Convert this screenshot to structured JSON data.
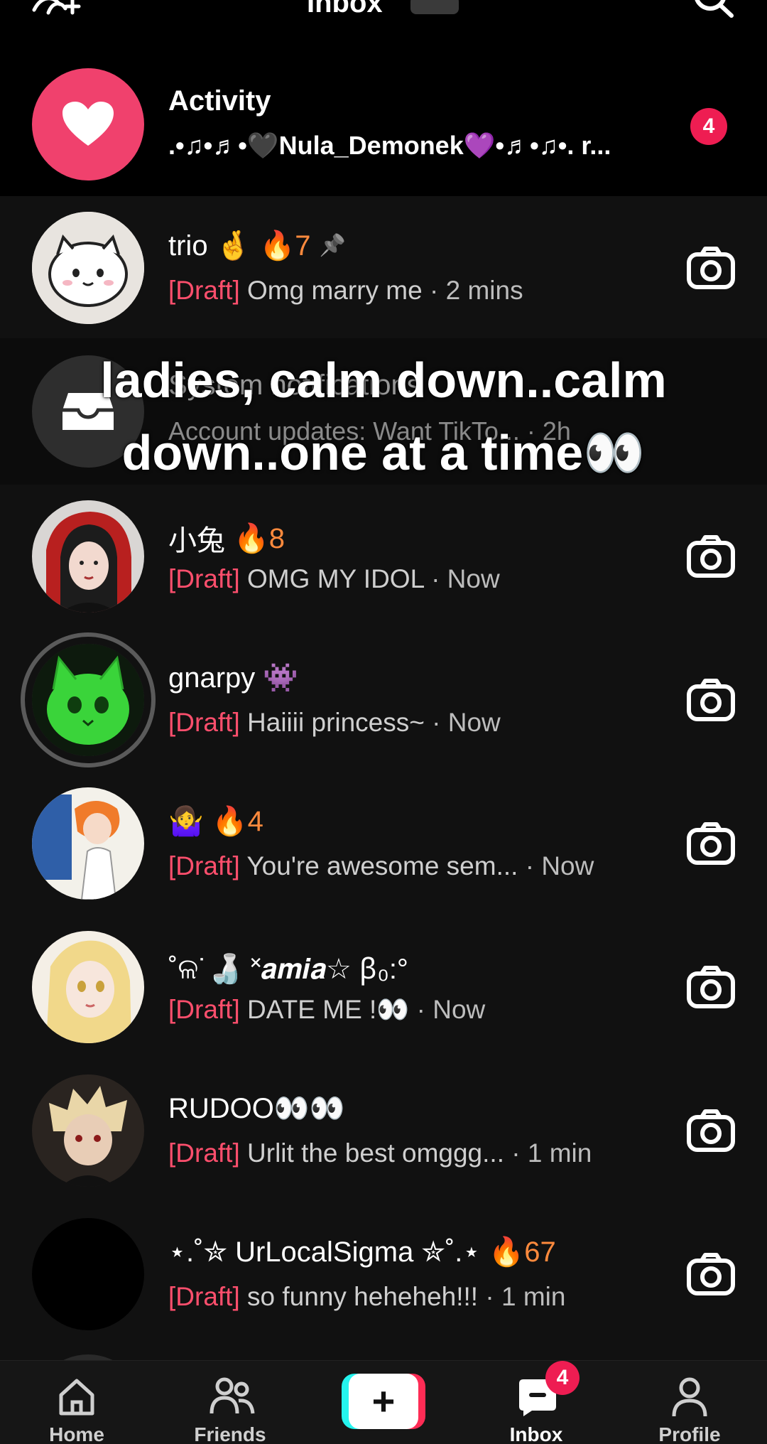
{
  "header": {
    "title": "Inbox"
  },
  "activity": {
    "name": "Activity",
    "subtitle": ".•♫•♬•🖤Nula_Demonek💜•♬•♫•. r...",
    "badge": "4"
  },
  "caption": {
    "line1": "ladies, calm down..calm",
    "line2": "down..one at a time👀"
  },
  "system_row_ghost": {
    "title": "System notifications",
    "subtitle": "Account updates: Want TikTo... · 2h"
  },
  "conversations": [
    {
      "name": "trio 🤞",
      "streak": "🔥7",
      "pinned": "📌",
      "draft": "[Draft]",
      "message": "Omg marry me",
      "time": "· 2 mins"
    },
    {
      "name": "小兔",
      "streak": "🔥8",
      "draft": "[Draft]",
      "message": "OMG MY IDOL",
      "time": "· Now"
    },
    {
      "name": "gnarpy 👾",
      "streak": "",
      "draft": "[Draft]",
      "message": "Haiiii princess~",
      "time": "· Now"
    },
    {
      "name": "🤷‍♀️",
      "streak": "🔥4",
      "draft": "[Draft]",
      "message": "You're awesome sem...",
      "time": "· Now"
    },
    {
      "name": "˚ଳ˙🍶 ˟𝒂𝒎𝒊𝒂☆ ꞵ₀:°",
      "streak": "",
      "draft": "[Draft]",
      "message": "DATE ME !👀",
      "time": "· Now"
    },
    {
      "name": "RUDOO👀👀",
      "streak": "",
      "draft": "[Draft]",
      "message": "Urlit the best omggg...",
      "time": "· 1 min"
    },
    {
      "name": "⋆.˚✮ UrLocalSigma ✮˚.⋆",
      "streak": "🔥67",
      "draft": "[Draft]",
      "message": "so funny heheheh!!!",
      "time": "· 1 min"
    }
  ],
  "nav": {
    "home": "Home",
    "friends": "Friends",
    "create": "+",
    "inbox": "Inbox",
    "inbox_badge": "4",
    "profile": "Profile"
  },
  "colors": {
    "accent_red": "#fe2c55",
    "draft_red": "#ff4f6d",
    "activity_pink": "#f0416d",
    "streak_orange": "#ff8a3d"
  }
}
